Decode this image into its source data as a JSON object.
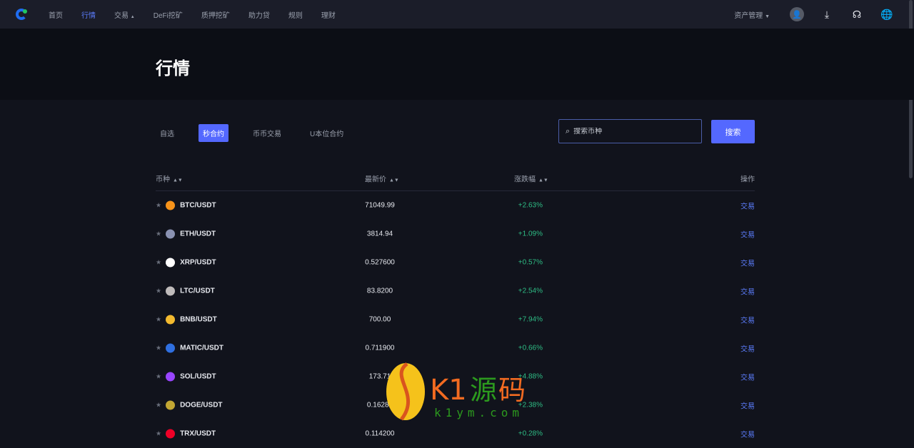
{
  "nav": {
    "items": [
      "首页",
      "行情",
      "交易",
      "DeFi挖矿",
      "质押挖矿",
      "助力贷",
      "规则",
      "理财"
    ],
    "active": 1,
    "asset_menu": "资产管理"
  },
  "page_title": "行情",
  "tabs": [
    "自选",
    "秒合约",
    "币币交易",
    "U本位合约"
  ],
  "active_tab": 1,
  "search": {
    "placeholder": "搜索币种",
    "button": "搜索"
  },
  "table": {
    "headers": [
      "币种",
      "最新价",
      "涨跌幅",
      "操作"
    ],
    "rows": [
      {
        "pair": "BTC/USDT",
        "price": "71049.99",
        "change": "+2.63%",
        "action": "交易",
        "color": "#f7931a"
      },
      {
        "pair": "ETH/USDT",
        "price": "3814.94",
        "change": "+1.09%",
        "action": "交易",
        "color": "#8a92b2"
      },
      {
        "pair": "XRP/USDT",
        "price": "0.527600",
        "change": "+0.57%",
        "action": "交易",
        "color": "#ffffff"
      },
      {
        "pair": "LTC/USDT",
        "price": "83.8200",
        "change": "+2.54%",
        "action": "交易",
        "color": "#bfbbbb"
      },
      {
        "pair": "BNB/USDT",
        "price": "700.00",
        "change": "+7.94%",
        "action": "交易",
        "color": "#f3ba2f"
      },
      {
        "pair": "MATIC/USDT",
        "price": "0.711900",
        "change": "+0.66%",
        "action": "交易",
        "color": "#2f6fe0"
      },
      {
        "pair": "SOL/USDT",
        "price": "173.71",
        "change": "+4.88%",
        "action": "交易",
        "color": "#9945ff"
      },
      {
        "pair": "DOGE/USDT",
        "price": "0.16282",
        "change": "+2.38%",
        "action": "交易",
        "color": "#c2a633"
      },
      {
        "pair": "TRX/USDT",
        "price": "0.114200",
        "change": "+0.28%",
        "action": "交易",
        "color": "#ef0027"
      }
    ]
  },
  "watermark": {
    "text": "K1源码",
    "url": "k1ym.com"
  }
}
